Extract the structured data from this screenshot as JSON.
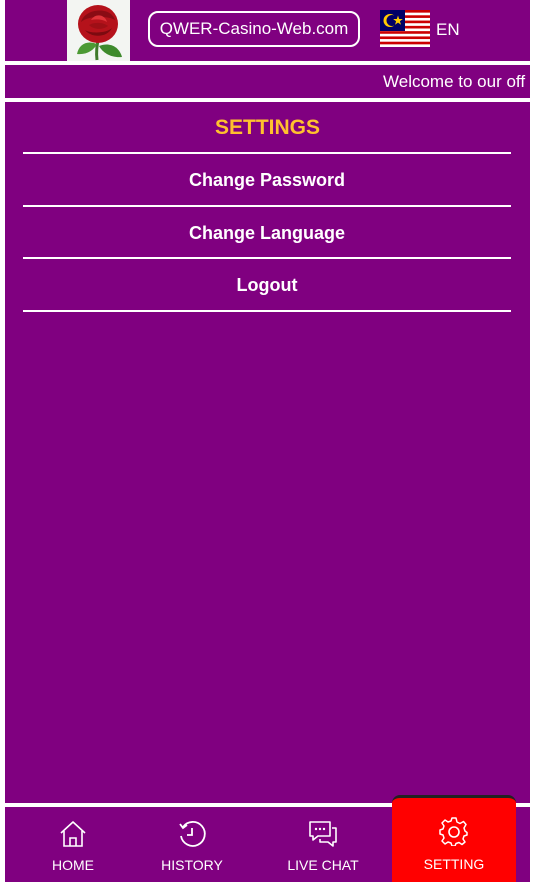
{
  "header": {
    "logo_icon": "red-rose-logo",
    "site_name": "QWER-Casino-Web.com",
    "language_flag_icon": "malaysia-flag-icon",
    "language_code": "EN"
  },
  "marquee": {
    "text": "Welcome to our off"
  },
  "settings": {
    "title": "SETTINGS",
    "items": [
      {
        "label": "Change Password"
      },
      {
        "label": "Change Language"
      },
      {
        "label": "Logout"
      }
    ]
  },
  "bottom_nav": {
    "items": [
      {
        "label": "HOME",
        "icon": "home-icon"
      },
      {
        "label": "HISTORY",
        "icon": "history-icon"
      },
      {
        "label": "LIVE CHAT",
        "icon": "chat-icon"
      },
      {
        "label": "SETTING",
        "icon": "gear-icon",
        "active": true
      }
    ]
  },
  "colors": {
    "background": "#800080",
    "title_accent": "#ffc12e",
    "active_nav": "#ff0000",
    "text": "#ffffff"
  }
}
